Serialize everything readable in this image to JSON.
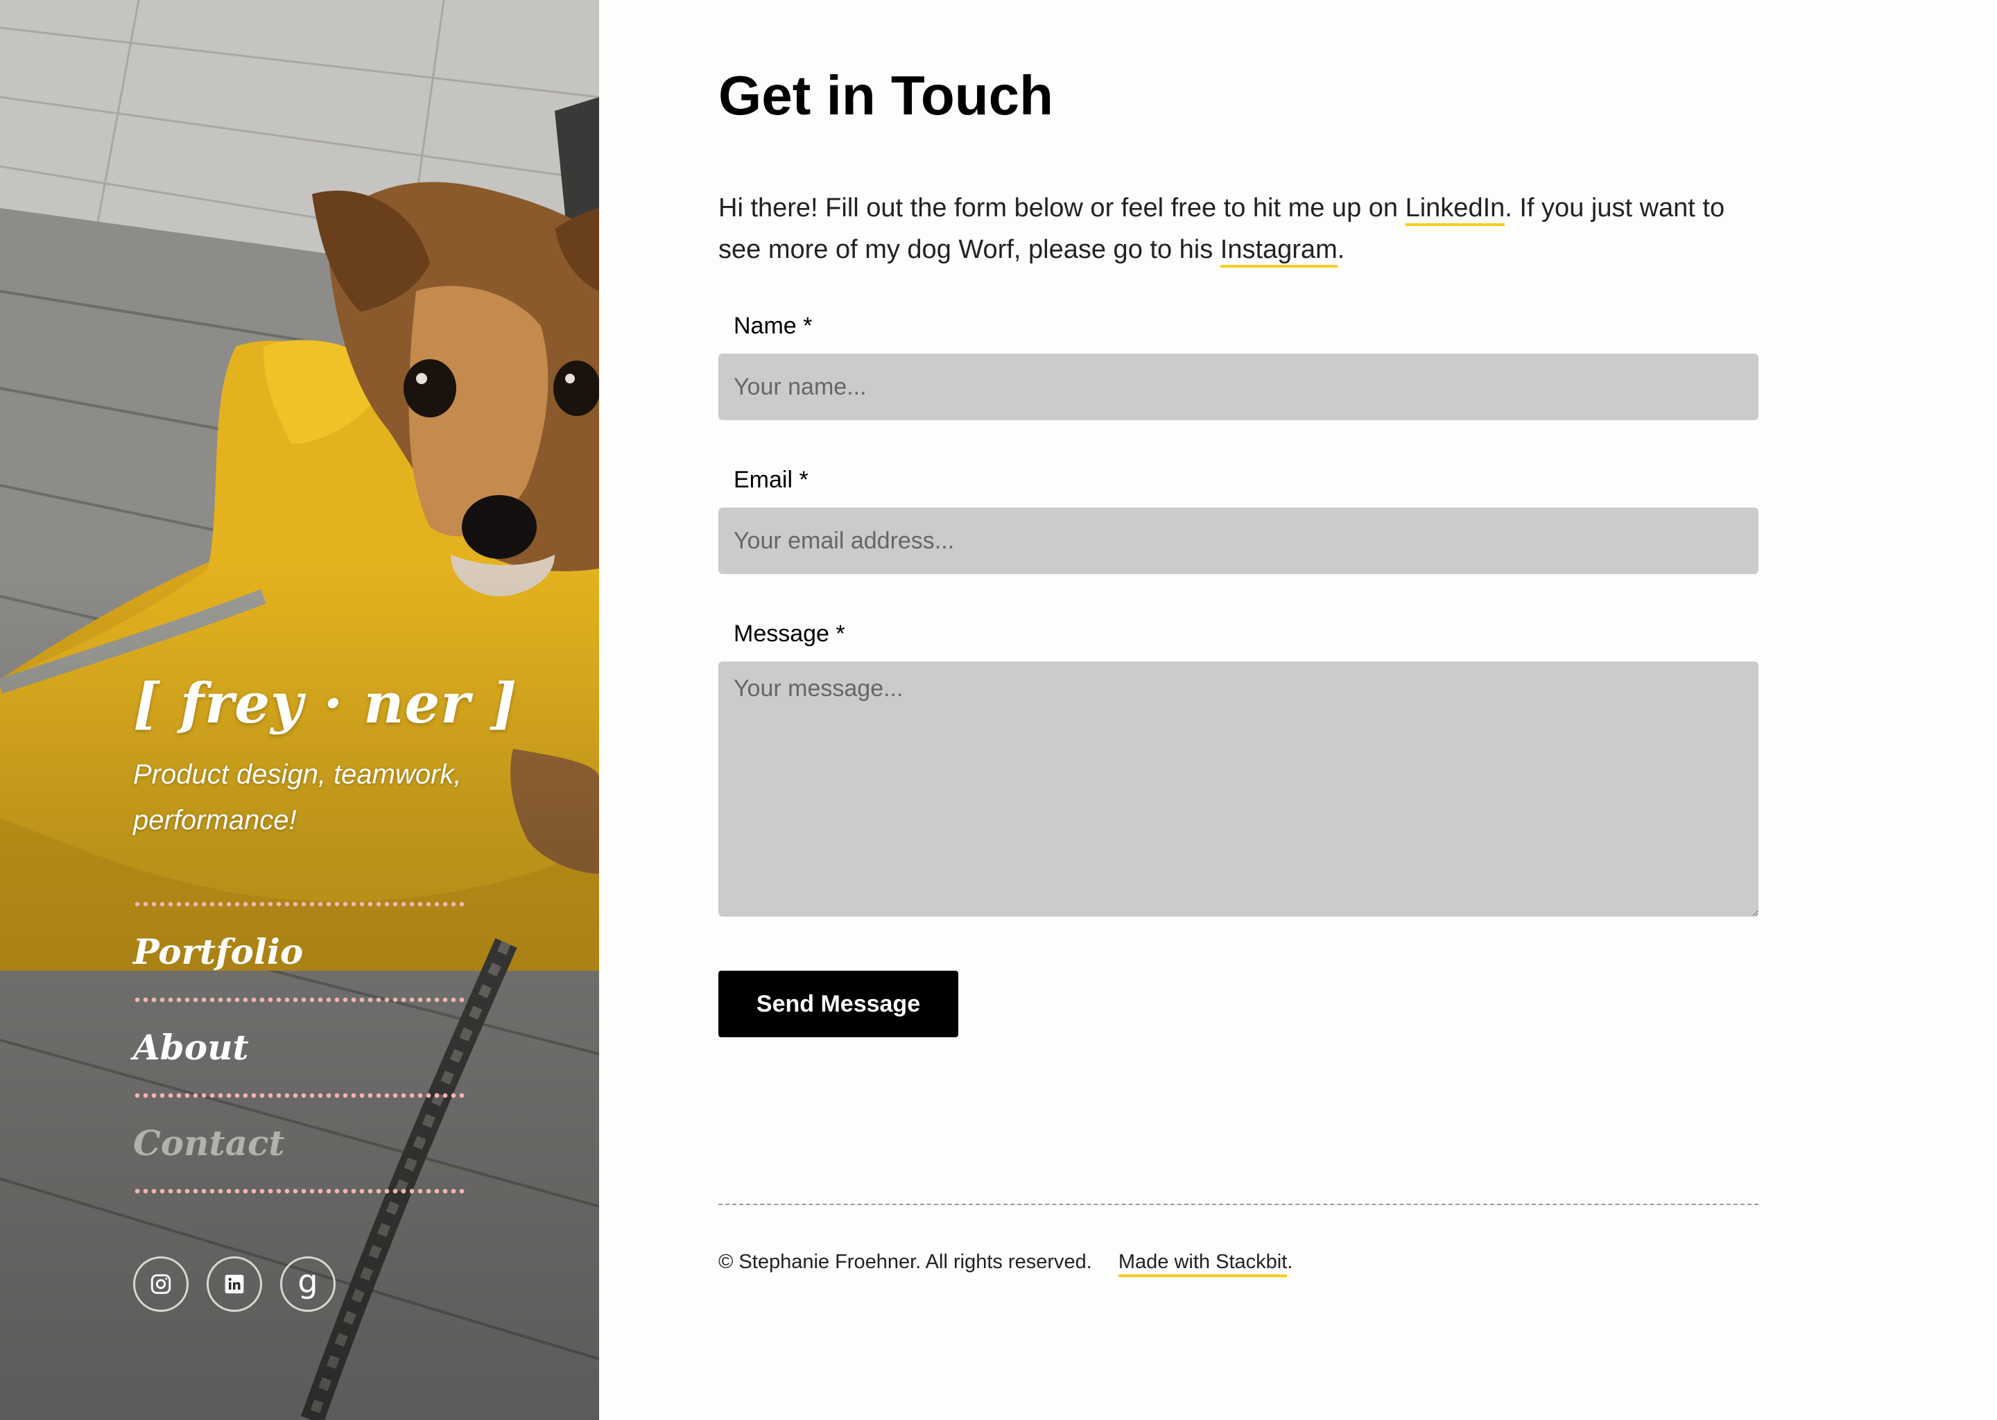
{
  "sidebar": {
    "logo": "[ frey · ner ]",
    "tagline": "Product design, teamwork, performance!",
    "nav": {
      "items": [
        {
          "label": "Portfolio",
          "active": false
        },
        {
          "label": "About",
          "active": false
        },
        {
          "label": "Contact",
          "active": true
        }
      ]
    },
    "socials": [
      {
        "icon": "instagram-icon"
      },
      {
        "icon": "linkedin-icon"
      },
      {
        "icon": "goodreads-icon",
        "glyph": "g"
      }
    ],
    "photo": {
      "subject": "small brown dog wearing a yellow raincoat"
    }
  },
  "main": {
    "title": "Get in Touch",
    "intro": {
      "before_linkedin": "Hi there! Fill out the form below or feel free to hit me up on ",
      "linkedin_label": "LinkedIn",
      "middle": ". If you just want to see more of my dog Worf, please go to his ",
      "instagram_label": "Instagram",
      "after": "."
    },
    "form": {
      "name": {
        "label": "Name *",
        "placeholder": "Your name..."
      },
      "email": {
        "label": "Email *",
        "placeholder": "Your email address..."
      },
      "message": {
        "label": "Message *",
        "placeholder": "Your message..."
      },
      "submit_label": "Send Message"
    }
  },
  "footer": {
    "copyright": "© Stephanie Froehner. All rights reserved.",
    "made_with_label": "Made with Stackbit",
    "made_with_suffix": "."
  },
  "colors": {
    "accent_underline": "#f5cc1f",
    "input_bg": "#cbcbca",
    "nav_dots": "#f3b5b0",
    "button_bg": "#000000",
    "page_bg": "#fdfdfb",
    "raincoat": "#e6b21e"
  }
}
